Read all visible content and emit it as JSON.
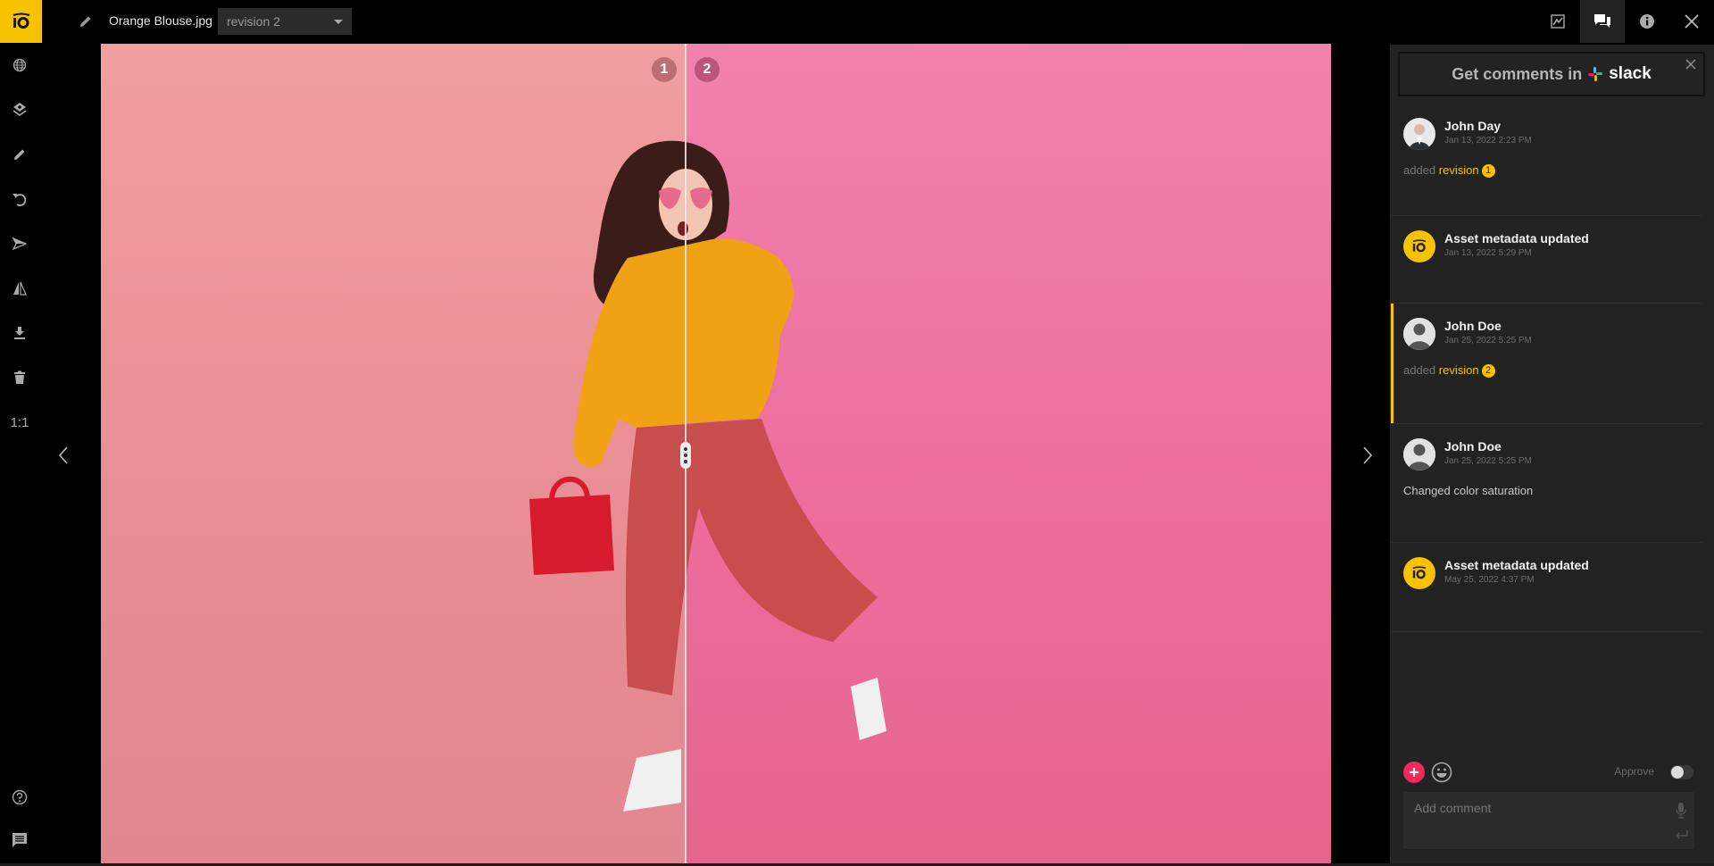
{
  "header": {
    "file_name": "Orange Blouse.jpg",
    "revision_selected": "revision 2",
    "top_icons": [
      "activity-chart-icon",
      "comments-icon",
      "info-icon",
      "close-icon"
    ]
  },
  "left_toolbar": {
    "tools": [
      "globe-icon",
      "layers-icon",
      "pencil-icon",
      "undo-icon",
      "send-icon",
      "compare-icon",
      "download-icon",
      "trash-icon"
    ],
    "zoom_label": "1:1",
    "bottom_tools": [
      "help-icon",
      "chat-icon"
    ]
  },
  "viewer": {
    "left_revision": "1",
    "right_revision": "2",
    "split_position_fraction": 0.475
  },
  "panel": {
    "slack_banner": {
      "text": "Get comments in",
      "brand": "slack"
    },
    "feed": [
      {
        "author": "John Day",
        "date": "Jan 13, 2022 2:23 PM",
        "avatar": "photo",
        "body_prefix": "added",
        "body_link": "revision",
        "revision_num": "1",
        "selected": false
      },
      {
        "author": "Asset metadata updated",
        "date": "Jan 13, 2022 5:29 PM",
        "avatar": "io"
      },
      {
        "author": "John Doe",
        "date": "Jan 25, 2022 5:25 PM",
        "avatar": "user",
        "body_prefix": "added",
        "body_link": "revision",
        "revision_num": "2",
        "selected": true
      },
      {
        "author": "John Doe",
        "date": "Jan 25, 2022 5:25 PM",
        "avatar": "user",
        "body_text": "Changed color saturation"
      },
      {
        "author": "Asset metadata updated",
        "date": "May 25, 2022 4:37 PM",
        "avatar": "io"
      }
    ],
    "composer": {
      "approve_label": "Approve",
      "approve_on": false,
      "placeholder": "Add comment",
      "value": ""
    }
  },
  "colors": {
    "accent": "#f7c300",
    "add_button": "#f0285e",
    "panel_bg": "#222222"
  }
}
